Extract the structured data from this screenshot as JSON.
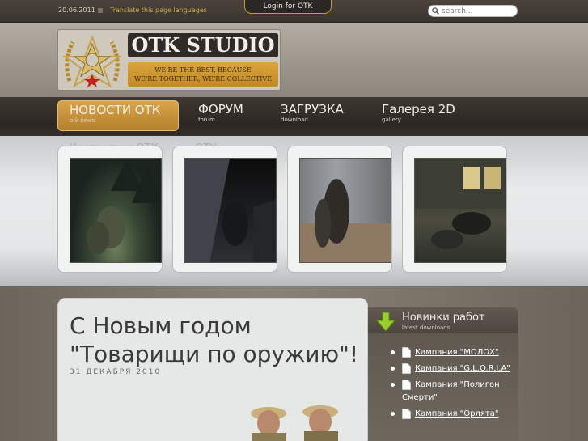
{
  "topbar": {
    "date": "20.06.2011",
    "translate_link": "Translate this page languages",
    "login_label": "Login for OTK",
    "search_placeholder": "search..."
  },
  "logo": {
    "title": "OTK STUDIO",
    "motto_line1": "WE'RE THE BEST, BECAUSE",
    "motto_line2": "WE'RE TOGETHER, WE'RE COLLECTIVE"
  },
  "nav": {
    "items": [
      {
        "label": "НОВОСТИ ОТК",
        "sub": "otk news"
      },
      {
        "label": "ФОРУМ",
        "sub": "forum"
      },
      {
        "label": "ЗАГРУЗКА",
        "sub": "download"
      },
      {
        "label": "Галерея 2D",
        "sub": "gallery"
      }
    ]
  },
  "gallery": {
    "overflow_text_1": "Контакты с ОТК",
    "overflow_text_2": "ОТК"
  },
  "article": {
    "title": "С Новым годом \"Товарищи по оружию\"!",
    "date": "31 ДЕКАБРЯ 2010"
  },
  "sidebar": {
    "title": "Новинки работ",
    "subtitle": "latest downloads",
    "items": [
      "Кампания \"МОЛОХ\"",
      "Кампания \"G.L.O.R.I.A\"",
      "Кампания \"Полигон Смерти\"",
      "Кампания \"Орлята\""
    ]
  },
  "colors": {
    "accent_gold": "#c9952f",
    "nav_bg": "#2c2723",
    "link_gold": "#c8a84a"
  }
}
